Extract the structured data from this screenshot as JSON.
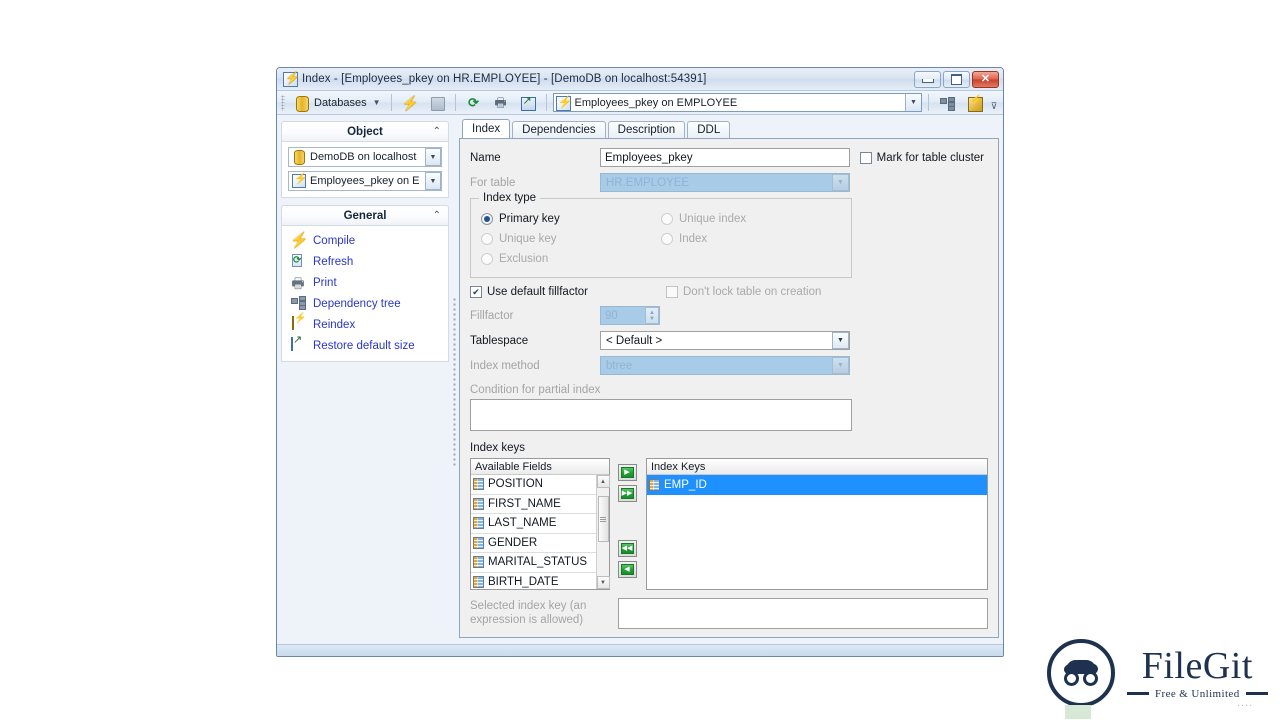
{
  "window": {
    "title": "Index - [Employees_pkey on HR.EMPLOYEE] - [DemoDB on localhost:54391]",
    "icon": "index-icon",
    "minimize_label": "Minimize",
    "maximize_label": "Maximize",
    "close_label": "Close"
  },
  "toolbar": {
    "databases_label": "Databases",
    "items": [
      {
        "name": "databases-dropdown",
        "label": "Databases",
        "icon": "database-icon"
      },
      {
        "name": "compile-button",
        "label": "Compile",
        "icon": "lightning-icon"
      },
      {
        "name": "stop-button",
        "label": "Stop",
        "icon": "box-icon"
      },
      {
        "name": "refresh-button",
        "label": "Refresh",
        "icon": "refresh-icon"
      },
      {
        "name": "print-button",
        "label": "Print",
        "icon": "printer-icon"
      },
      {
        "name": "restore-default-size-button",
        "label": "Restore default size",
        "icon": "restore-icon"
      },
      {
        "name": "dependency-tree-button",
        "label": "Dependency tree",
        "icon": "dependency-tree-icon"
      },
      {
        "name": "reindex-button",
        "label": "Reindex",
        "icon": "reindex-icon"
      }
    ],
    "object_combo": {
      "value": "Employees_pkey on EMPLOYEE",
      "icon": "index-icon"
    }
  },
  "sidebar": {
    "object_group": {
      "title": "Object",
      "collapse_icon": "chevron-up-icon",
      "combos": [
        {
          "name": "database-combo",
          "value": "DemoDB on localhost",
          "icon": "database-icon"
        },
        {
          "name": "index-combo",
          "value": "Employees_pkey on E",
          "icon": "index-icon"
        }
      ]
    },
    "general_group": {
      "title": "General",
      "collapse_icon": "chevron-up-icon",
      "links": [
        {
          "name": "compile",
          "label": "Compile",
          "icon": "lightning-icon"
        },
        {
          "name": "refresh",
          "label": "Refresh",
          "icon": "refresh-icon"
        },
        {
          "name": "print",
          "label": "Print",
          "icon": "printer-icon"
        },
        {
          "name": "dependency-tree",
          "label": "Dependency tree",
          "icon": "dependency-tree-icon"
        },
        {
          "name": "reindex",
          "label": "Reindex",
          "icon": "reindex-icon"
        },
        {
          "name": "restore-default-size",
          "label": "Restore default size",
          "icon": "restore-icon"
        }
      ]
    }
  },
  "tabs": [
    {
      "label": "Index",
      "active": true
    },
    {
      "label": "Dependencies",
      "active": false
    },
    {
      "label": "Description",
      "active": false
    },
    {
      "label": "DDL",
      "active": false
    }
  ],
  "form": {
    "name_label": "Name",
    "name_value": "Employees_pkey",
    "mark_cluster_label": "Mark for table cluster",
    "mark_cluster_checked": false,
    "for_table_label": "For table",
    "for_table_value": "HR.EMPLOYEE",
    "index_type_caption": "Index type",
    "index_type_options": [
      {
        "label": "Primary key",
        "selected": true,
        "disabled": false
      },
      {
        "label": "Unique index",
        "selected": false,
        "disabled": true
      },
      {
        "label": "Unique key",
        "selected": false,
        "disabled": true
      },
      {
        "label": "Index",
        "selected": false,
        "disabled": true
      },
      {
        "label": "Exclusion",
        "selected": false,
        "disabled": true
      }
    ],
    "use_default_fillfactor_label": "Use default fillfactor",
    "use_default_fillfactor_checked": true,
    "dont_lock_label": "Don't lock table on creation",
    "dont_lock_checked": false,
    "fillfactor_label": "Fillfactor",
    "fillfactor_value": "90",
    "tablespace_label": "Tablespace",
    "tablespace_value": "< Default >",
    "index_method_label": "Index method",
    "index_method_value": "btree",
    "condition_label": "Condition for partial index",
    "condition_value": ""
  },
  "index_keys": {
    "section_label": "Index keys",
    "available_header": "Available Fields",
    "available_fields": [
      "POSITION",
      "FIRST_NAME",
      "LAST_NAME",
      "GENDER",
      "MARITAL_STATUS",
      "BIRTH_DATE"
    ],
    "keys_header": "Index Keys",
    "keys": [
      {
        "label": "EMP_ID",
        "selected": true
      }
    ],
    "buttons": [
      {
        "name": "add-key-button",
        "glyph": "▶"
      },
      {
        "name": "add-all-keys-button",
        "glyph": "▶▶"
      },
      {
        "name": "remove-all-keys-button",
        "glyph": "◀◀"
      },
      {
        "name": "remove-key-button",
        "glyph": "◀"
      }
    ],
    "selected_key_label": "Selected index key (an expression is allowed)",
    "selected_key_value": ""
  },
  "watermark": {
    "name": "FileGit",
    "tagline": "Free & Unlimited",
    "ghost": "...."
  }
}
